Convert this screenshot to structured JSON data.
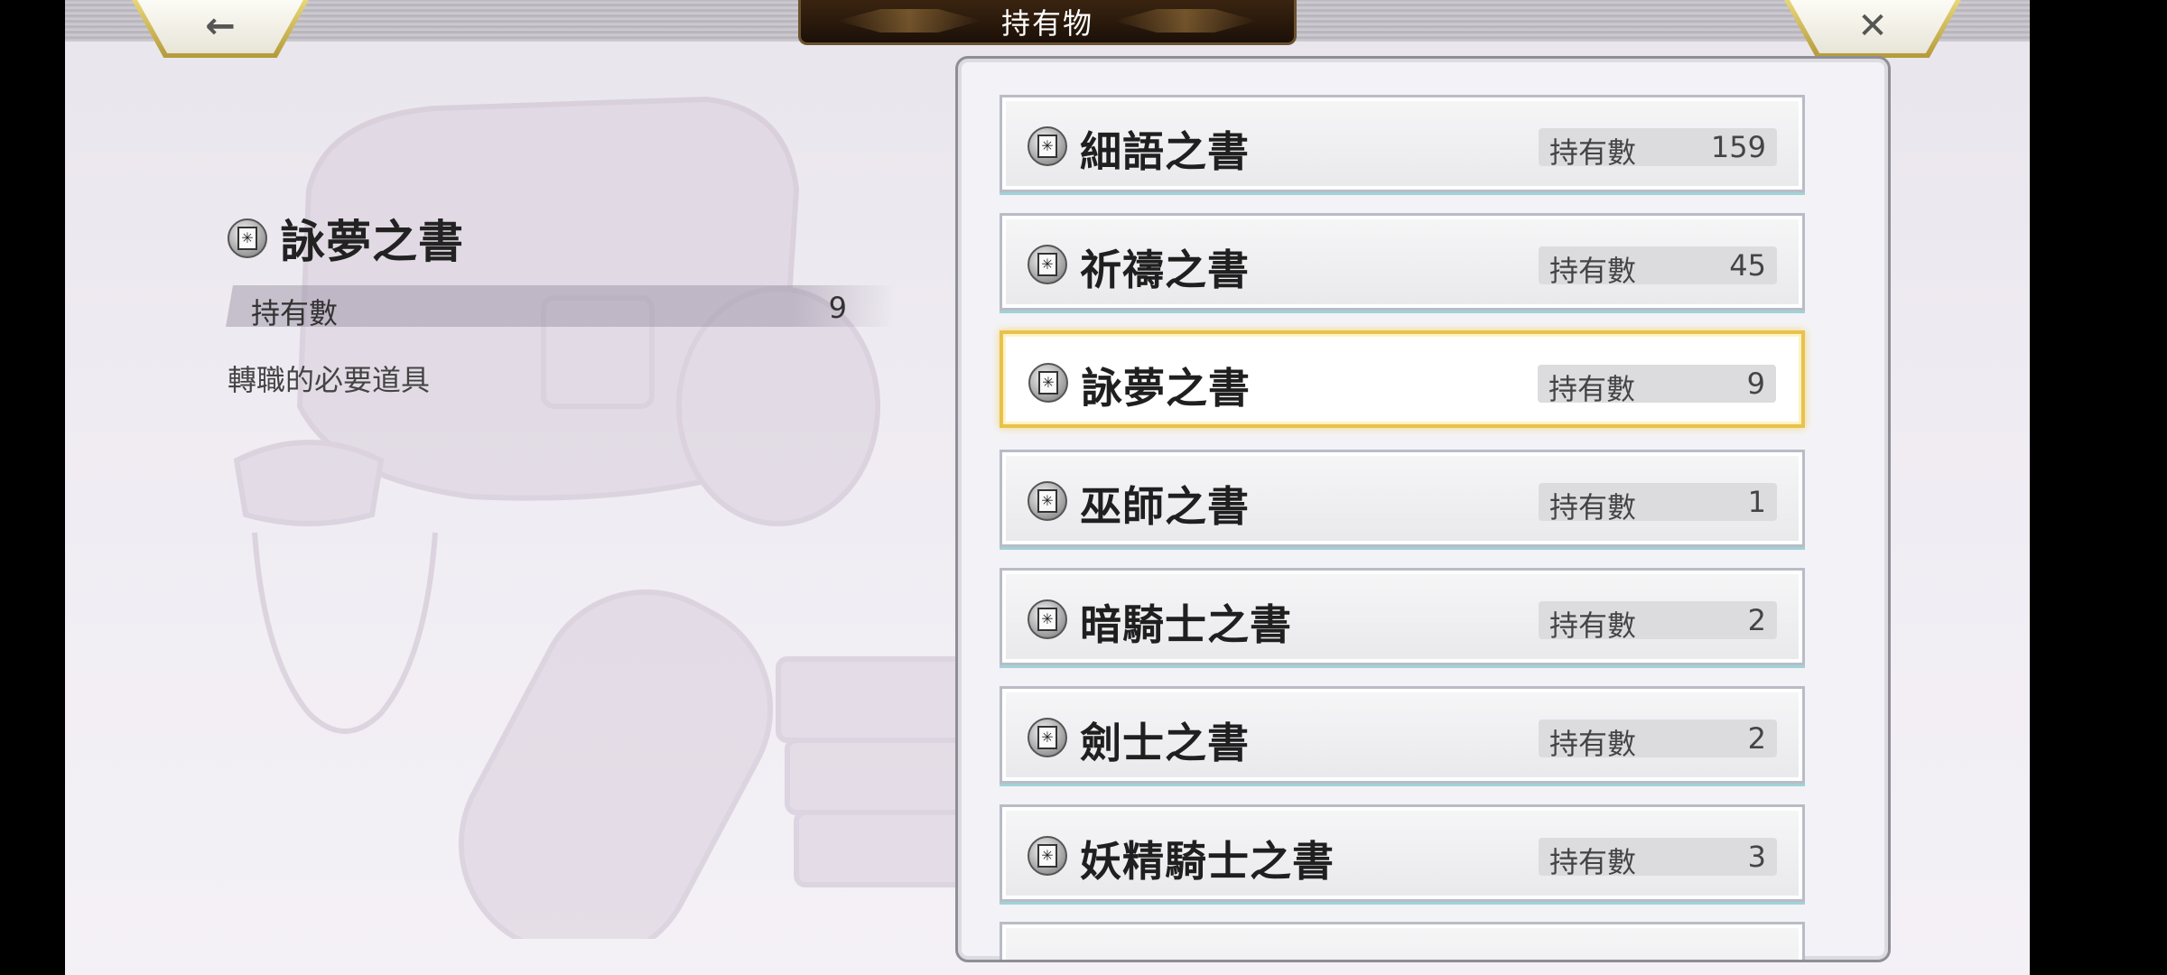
{
  "header": {
    "title": "持有物"
  },
  "nav": {
    "back_glyph": "←",
    "close_glyph": "✕"
  },
  "detail": {
    "name": "詠夢之書",
    "count_label": "持有數",
    "count_value": "9",
    "description": "轉職的必要道具"
  },
  "items": [
    {
      "name": "細語之書",
      "count_label": "持有數",
      "count": "159",
      "selected": false
    },
    {
      "name": "祈禱之書",
      "count_label": "持有數",
      "count": "45",
      "selected": false
    },
    {
      "name": "詠夢之書",
      "count_label": "持有數",
      "count": "9",
      "selected": true
    },
    {
      "name": "巫師之書",
      "count_label": "持有數",
      "count": "1",
      "selected": false
    },
    {
      "name": "暗騎士之書",
      "count_label": "持有數",
      "count": "2",
      "selected": false
    },
    {
      "name": "劍士之書",
      "count_label": "持有數",
      "count": "2",
      "selected": false
    },
    {
      "name": "妖精騎士之書",
      "count_label": "持有數",
      "count": "3",
      "selected": false
    }
  ],
  "icons": {
    "item_icon": "book-icon"
  },
  "colors": {
    "selected_border": "#e8c24a",
    "header_bg": "#2a1a0c",
    "accent_gold": "#d8c264"
  },
  "scroll": {
    "position": 0.0,
    "visible_fraction": 0.18
  }
}
